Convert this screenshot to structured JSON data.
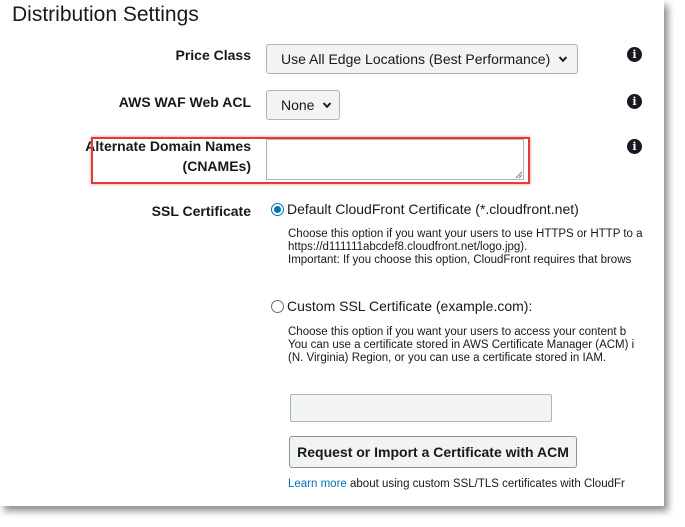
{
  "title": "Distribution Settings",
  "fields": {
    "price_class": {
      "label": "Price Class",
      "value": "Use All Edge Locations (Best Performance)"
    },
    "waf": {
      "label": "AWS WAF Web ACL",
      "value": "None"
    },
    "cnames": {
      "label_line1": "Alternate Domain Names",
      "label_line2": "(CNAMEs)",
      "value": ""
    },
    "ssl": {
      "label": "SSL Certificate",
      "default_option": {
        "label": "Default CloudFront Certificate (*.cloudfront.net)",
        "checked": true,
        "desc_lines": [
          "Choose this option if you want your users to use HTTPS or HTTP to a",
          "https://d111111abcdef8.cloudfront.net/logo.jpg).",
          "Important: If you choose this option, CloudFront requires that brows"
        ]
      },
      "custom_option": {
        "label": "Custom SSL Certificate (example.com):",
        "checked": false,
        "desc_lines": [
          "Choose this option if you want your users to access your content b",
          "You can use a certificate stored in AWS Certificate Manager (ACM) i",
          "(N. Virginia) Region, or you can use a certificate stored in IAM."
        ]
      },
      "certificate_value": "",
      "request_button": "Request or Import a Certificate with ACM",
      "learn_more_link": "Learn more",
      "learn_more_text": " about using custom SSL/TLS certificates with CloudFr"
    }
  },
  "colors": {
    "highlight_box": "#e03b3b",
    "radio_accent": "#0073bb",
    "link": "#0073bb"
  },
  "icons": {
    "info": "info-circle-icon",
    "dropdown": "chevron-down-icon"
  }
}
